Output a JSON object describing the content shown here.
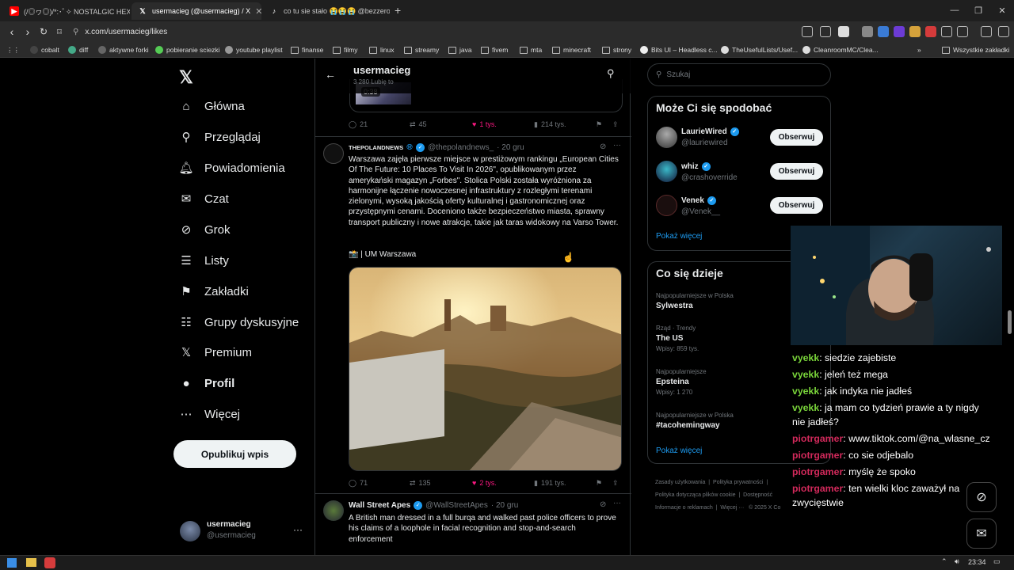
{
  "browser": {
    "tabs": [
      {
        "label": "(/◎ヮ◎)/*:･ﾟ✧ NOSTALGIC HEXD",
        "active": false
      },
      {
        "label": "usermacieg (@usermacieg) / X",
        "active": true
      },
      {
        "label": "co tu sie stało 😭😭😭 @bezzeroffic",
        "active": false
      }
    ],
    "url": "x.com/usermacieg/likes",
    "bookmarks": [
      "cobalt",
      "diff",
      "aktywne forki",
      "pobieranie sciezki",
      "youtube playlist",
      "finanse",
      "filmy",
      "linux",
      "streamy",
      "java",
      "fivem",
      "mta",
      "minecraft",
      "strony",
      "Bits UI – Headless c...",
      "TheUsefulLists/Usef...",
      "CleanroomMC/Clea..."
    ],
    "all_bookmarks": "Wszystkie zakładki"
  },
  "sidebar": {
    "items": [
      {
        "label": "Główna",
        "icon": "home-icon"
      },
      {
        "label": "Przeglądaj",
        "icon": "search-icon"
      },
      {
        "label": "Powiadomienia",
        "icon": "bell-icon"
      },
      {
        "label": "Czat",
        "icon": "mail-icon"
      },
      {
        "label": "Grok",
        "icon": "grok-icon"
      },
      {
        "label": "Listy",
        "icon": "list-icon"
      },
      {
        "label": "Zakładki",
        "icon": "bookmark-icon"
      },
      {
        "label": "Grupy dyskusyjne",
        "icon": "community-icon"
      },
      {
        "label": "Premium",
        "icon": "x-logo-icon"
      },
      {
        "label": "Profil",
        "icon": "person-icon"
      },
      {
        "label": "Więcej",
        "icon": "more-icon"
      }
    ],
    "post_button": "Opublikuj wpis",
    "account": {
      "name": "usermacieg",
      "handle": "@usermacieg"
    }
  },
  "feed": {
    "header": {
      "title": "usermacieg",
      "subtitle": "3 280 Lubię to"
    },
    "video_time": "0:38",
    "tweet0_actions": {
      "replies": "21",
      "retweets": "45",
      "likes": "1 tys.",
      "views": "214 tys."
    },
    "tweet1": {
      "name": "THEPOLANDNEWS",
      "handle": "@thepolandnews_",
      "date": "· 20 gru",
      "text": "Warszawa zajęła pierwsze miejsce w prestiżowym rankingu „European Cities Of The Future: 10 Places To Visit In 2026\", opublikowanym przez amerykański magazyn „Forbes\". Stolica Polski została wyróżniona za harmonijne łączenie nowoczesnej infrastruktury z rozległymi terenami zielonymi, wysoką jakością oferty kulturalnej i gastronomicznej oraz przystępnymi cenami. Doceniono także bezpieczeństwo miasta, sprawny transport publiczny i nowe atrakcje, takie jak taras widokowy na Varso Tower.",
      "credit": "📸 | UM Warszawa",
      "actions": {
        "replies": "71",
        "retweets": "135",
        "likes": "2 tys.",
        "views": "191 tys."
      }
    },
    "tweet2": {
      "name": "Wall Street Apes",
      "handle": "@WallStreetApes",
      "date": "· 20 gru",
      "text": "A British man dressed in a full burqa and walked past police officers to prove his claims of a loophole in facial recognition and stop-and-search enforcement"
    }
  },
  "right": {
    "search_placeholder": "Szukaj",
    "suggest_title": "Może Ci się spodobać",
    "suggestions": [
      {
        "name": "LaurieWired",
        "handle": "@lauriewired",
        "button": "Obserwuj"
      },
      {
        "name": "whiz",
        "handle": "@crashoverride",
        "button": "Obserwuj"
      },
      {
        "name": "Venek",
        "handle": "@Venek__",
        "button": "Obserwuj"
      }
    ],
    "show_more": "Pokaż więcej",
    "trends_title": "Co się dzieje",
    "trends": [
      {
        "category": "Najpopularniejsze w Polska",
        "name": "Sylwestra",
        "posts": ""
      },
      {
        "category": "Rząd · Trendy",
        "name": "The US",
        "posts": "Wpisy: 859 tys."
      },
      {
        "category": "Najpopularniejsze",
        "name": "Epsteina",
        "posts": "Wpisy: 1 270"
      },
      {
        "category": "Najpopularniejsze w Polska",
        "name": "#tacohemingway",
        "posts": ""
      }
    ],
    "trends_more": "Pokaż więcej",
    "footer": [
      "Zasady użytkowania",
      "Polityka prywatności",
      "Polityka dotycząca plików cookie",
      "Dostępność",
      "Informacje o reklamach",
      "Więcej ···",
      "© 2025 X Co"
    ]
  },
  "chat": [
    {
      "user": "vyekk",
      "text": ": siedzie zajebiste",
      "color": "#7ad53a"
    },
    {
      "user": "vyekk",
      "text": ": jeleń też mega",
      "color": "#7ad53a"
    },
    {
      "user": "vyekk",
      "text": ": jak indyka nie jadłeś",
      "color": "#7ad53a"
    },
    {
      "user": "vyekk",
      "text": ": ja mam co tydzień prawie a ty nigdy",
      "color": "#7ad53a"
    },
    {
      "user": "",
      "text": "nie jadłeś?",
      "color": "#7ad53a"
    },
    {
      "user": "piotrgamer",
      "text": ": www.tiktok.com/@na_wlasne_cz",
      "color": "#d2295b"
    },
    {
      "user": "piotrgamer",
      "text": ": co sie odjebalo",
      "color": "#d2295b"
    },
    {
      "user": "piotrgamer",
      "text": ": myślę że spoko",
      "color": "#d2295b"
    },
    {
      "user": "piotrgamer",
      "text": ": ten wielki kloc zaważył na",
      "color": "#d2295b"
    },
    {
      "user": "",
      "text": "zwycięstwie",
      "color": "#d2295b"
    }
  ],
  "taskbar": {
    "time": "23:34"
  },
  "colors": {
    "accent": "#1d9bf0",
    "like": "#f91880",
    "bg": "#000000"
  }
}
